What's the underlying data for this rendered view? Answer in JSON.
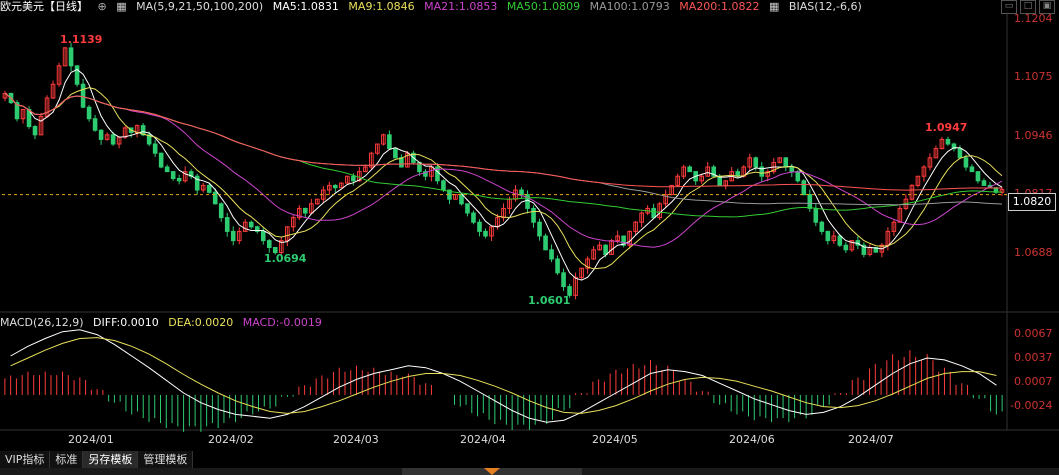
{
  "header": {
    "symbol": "欧元美元【日线】",
    "symbol_icon": "target-icon",
    "ma_label": "MA(5,9,21,50,100,200)",
    "ma5": "MA5:1.0831",
    "ma9": "MA9:1.0846",
    "ma21": "MA21:1.0853",
    "ma50": "MA50:1.0809",
    "ma100": "MA100:1.0793",
    "ma200": "MA200:1.0822",
    "bias": "BIAS(12,-6,6)"
  },
  "macd_header": {
    "label": "MACD(26,12,9)",
    "diff": "DIFF:0.0010",
    "dea": "DEA:0.0020",
    "macd": "MACD:-0.0019"
  },
  "colors": {
    "up": "#ff3b3b",
    "down": "#2ecc71",
    "ma5": "#ffffff",
    "ma9": "#e8e05a",
    "ma21": "#cc44cc",
    "ma50": "#33cc33",
    "ma100": "#999999",
    "ma200": "#ff5555"
  },
  "price_axis": {
    "labels": [
      "1.1204",
      "1.1075",
      "1.0946",
      "1.0817",
      "1.0688"
    ],
    "current": "1.0820"
  },
  "macd_axis": {
    "labels": [
      "0.0067",
      "0.0037",
      "0.0007",
      "-0.0024"
    ]
  },
  "x_axis": {
    "labels": [
      "2024/01",
      "2024/02",
      "2024/03",
      "2024/04",
      "2024/05",
      "2024/06",
      "2024/07"
    ]
  },
  "annotations": {
    "high1": "1.1139",
    "low1": "1.0694",
    "low2": "1.0601",
    "high2": "1.0947"
  },
  "tabs": [
    "VIP指标",
    "标准",
    "另存模板",
    "管理模板"
  ],
  "active_tab": 2,
  "window_controls": [
    "restore-icon",
    "maximize-icon"
  ],
  "chart_data": {
    "type": "candlestick",
    "ylim": [
      1.058,
      1.1204
    ],
    "closes": [
      1.104,
      1.102,
      1.0985,
      1.1005,
      1.0968,
      1.095,
      1.099,
      1.103,
      1.106,
      1.11,
      1.1139,
      1.11,
      1.106,
      1.101,
      1.0985,
      1.096,
      1.094,
      1.095,
      1.093,
      1.0945,
      1.0965,
      1.0955,
      1.097,
      1.095,
      1.093,
      1.091,
      1.088,
      1.087,
      1.0855,
      1.085,
      1.087,
      1.086,
      1.083,
      1.084,
      1.0825,
      1.08,
      1.077,
      1.074,
      1.072,
      1.074,
      1.076,
      1.075,
      1.074,
      1.072,
      1.0705,
      1.0694,
      1.072,
      1.075,
      1.077,
      1.079,
      1.078,
      1.08,
      1.081,
      1.083,
      1.084,
      1.0835,
      1.0845,
      1.086,
      1.085,
      1.087,
      1.088,
      1.091,
      1.093,
      1.095,
      1.092,
      1.09,
      1.088,
      1.091,
      1.089,
      1.087,
      1.086,
      1.088,
      1.085,
      1.083,
      1.081,
      1.082,
      1.08,
      1.078,
      1.076,
      1.074,
      1.073,
      1.075,
      1.077,
      1.079,
      1.081,
      1.083,
      1.082,
      1.079,
      1.076,
      1.073,
      1.07,
      1.068,
      1.065,
      1.062,
      1.0601,
      1.064,
      1.066,
      1.068,
      1.07,
      1.071,
      1.069,
      1.072,
      1.073,
      1.071,
      1.074,
      1.076,
      1.078,
      1.079,
      1.077,
      1.08,
      1.082,
      1.084,
      1.086,
      1.088,
      1.087,
      1.085,
      1.086,
      1.088,
      1.086,
      1.084,
      1.085,
      1.087,
      1.086,
      1.088,
      1.09,
      1.088,
      1.086,
      1.087,
      1.089,
      1.09,
      1.088,
      1.087,
      1.085,
      1.082,
      1.079,
      1.076,
      1.074,
      1.072,
      1.073,
      1.071,
      1.07,
      1.072,
      1.071,
      1.069,
      1.0705,
      1.0695,
      1.071,
      1.074,
      1.076,
      1.079,
      1.081,
      1.084,
      1.086,
      1.088,
      1.09,
      1.092,
      1.094,
      1.093,
      1.092,
      1.09,
      1.088,
      1.087,
      1.085,
      1.084,
      1.0835,
      1.0825,
      1.0831
    ],
    "macd": {
      "diff": [
        0.004,
        0.005,
        0.0058,
        0.0065,
        0.0067,
        0.0062,
        0.0052,
        0.004,
        0.0028,
        0.0015,
        0.0002,
        -0.0008,
        -0.0015,
        -0.002,
        -0.0022,
        -0.0024,
        -0.002,
        -0.0012,
        -0.0002,
        0.0008,
        0.0016,
        0.0022,
        0.0026,
        0.003,
        0.0028,
        0.0022,
        0.0014,
        0.0004,
        -0.0006,
        -0.0016,
        -0.0024,
        -0.0028,
        -0.0026,
        -0.0018,
        -0.0008,
        0.0002,
        0.0012,
        0.0022,
        0.0026,
        0.0024,
        0.002,
        0.0012,
        0.0004,
        -0.0004,
        -0.001,
        -0.0016,
        -0.002,
        -0.0018,
        -0.0012,
        -0.0002,
        0.001,
        0.0022,
        0.0032,
        0.0038,
        0.0036,
        0.003,
        0.0022,
        0.001
      ],
      "dea": [
        0.003,
        0.0038,
        0.0046,
        0.0053,
        0.0058,
        0.0059,
        0.0056,
        0.005,
        0.0042,
        0.0032,
        0.0021,
        0.0011,
        0.0002,
        -0.0006,
        -0.0012,
        -0.0017,
        -0.0019,
        -0.0017,
        -0.0012,
        -0.0006,
        0.0001,
        0.0008,
        0.0014,
        0.0019,
        0.0022,
        0.0022,
        0.002,
        0.0015,
        0.0009,
        0.0002,
        -0.0006,
        -0.0013,
        -0.0018,
        -0.0019,
        -0.0016,
        -0.0011,
        -0.0004,
        0.0004,
        0.0011,
        0.0016,
        0.0018,
        0.0017,
        0.0014,
        0.0009,
        0.0004,
        -0.0002,
        -0.0008,
        -0.0012,
        -0.0013,
        -0.0011,
        -0.0006,
        0.0001,
        0.0009,
        0.0017,
        0.0022,
        0.0024,
        0.0024,
        0.002
      ]
    }
  }
}
